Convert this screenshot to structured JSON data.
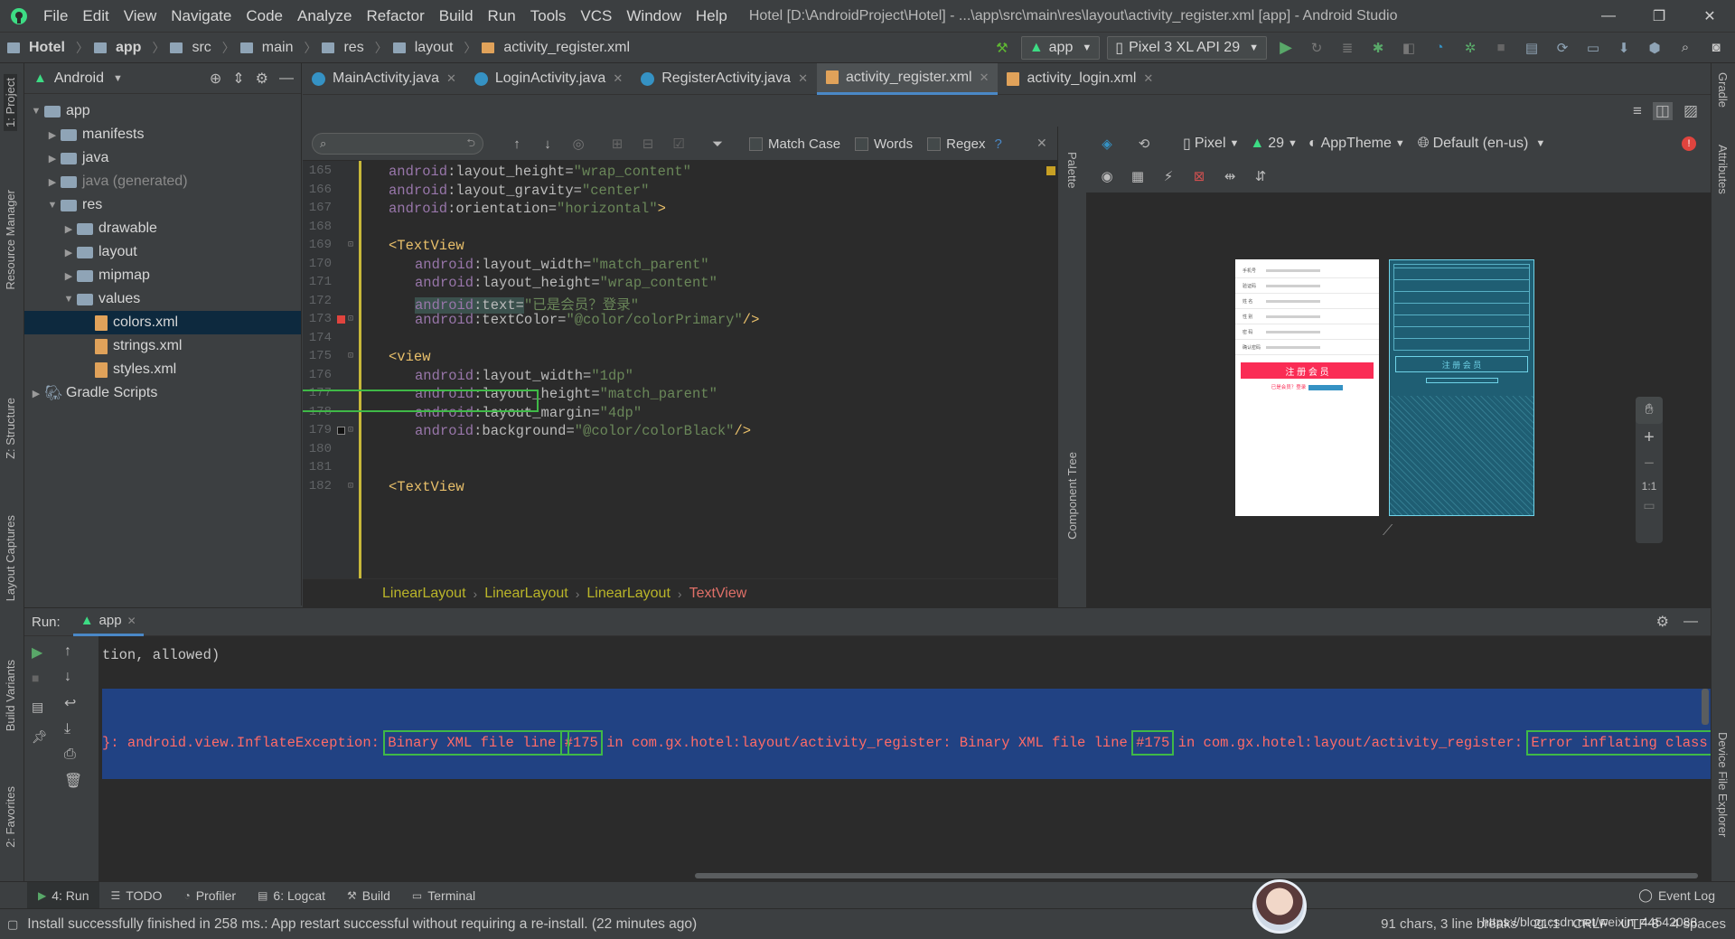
{
  "window": {
    "menu": [
      "File",
      "Edit",
      "View",
      "Navigate",
      "Code",
      "Analyze",
      "Refactor",
      "Build",
      "Run",
      "Tools",
      "VCS",
      "Window",
      "Help"
    ],
    "title": "Hotel [D:\\AndroidProject\\Hotel] - ...\\app\\src\\main\\res\\layout\\activity_register.xml [app] - Android Studio"
  },
  "breadcrumbs": [
    "Hotel",
    "app",
    "src",
    "main",
    "res",
    "layout",
    "activity_register.xml"
  ],
  "toolbar": {
    "run_config": "app",
    "device": "Pixel 3 XL API 29"
  },
  "project": {
    "view_mode": "Android",
    "tree": [
      {
        "label": "app",
        "depth": 0,
        "arrow": "▼",
        "kind": "folder"
      },
      {
        "label": "manifests",
        "depth": 1,
        "arrow": "▶",
        "kind": "folder"
      },
      {
        "label": "java",
        "depth": 1,
        "arrow": "▶",
        "kind": "folder"
      },
      {
        "label": "java (generated)",
        "depth": 1,
        "arrow": "▶",
        "kind": "folder",
        "dim": true
      },
      {
        "label": "res",
        "depth": 1,
        "arrow": "▼",
        "kind": "folder"
      },
      {
        "label": "drawable",
        "depth": 2,
        "arrow": "▶",
        "kind": "folder"
      },
      {
        "label": "layout",
        "depth": 2,
        "arrow": "▶",
        "kind": "folder"
      },
      {
        "label": "mipmap",
        "depth": 2,
        "arrow": "▶",
        "kind": "folder"
      },
      {
        "label": "values",
        "depth": 2,
        "arrow": "▼",
        "kind": "folder"
      },
      {
        "label": "colors.xml",
        "depth": 3,
        "arrow": "",
        "kind": "xml",
        "selected": true
      },
      {
        "label": "strings.xml",
        "depth": 3,
        "arrow": "",
        "kind": "xml"
      },
      {
        "label": "styles.xml",
        "depth": 3,
        "arrow": "",
        "kind": "xml"
      },
      {
        "label": "Gradle Scripts",
        "depth": 0,
        "arrow": "▶",
        "kind": "gradle"
      }
    ]
  },
  "tabs": [
    {
      "label": "MainActivity.java",
      "kind": "class",
      "active": false
    },
    {
      "label": "LoginActivity.java",
      "kind": "class",
      "active": false
    },
    {
      "label": "RegisterActivity.java",
      "kind": "class",
      "active": false
    },
    {
      "label": "activity_register.xml",
      "kind": "xml",
      "active": true
    },
    {
      "label": "activity_login.xml",
      "kind": "xml",
      "active": false
    }
  ],
  "find": {
    "match_case": "Match Case",
    "words": "Words",
    "regex": "Regex",
    "help": "?"
  },
  "code": {
    "lines": [
      {
        "n": "165",
        "indent": 0,
        "parts": [
          [
            "ns",
            "android"
          ],
          [
            "attr",
            ":layout_height="
          ],
          [
            "str",
            "\"wrap_content\""
          ]
        ]
      },
      {
        "n": "166",
        "indent": 0,
        "parts": [
          [
            "ns",
            "android"
          ],
          [
            "attr",
            ":layout_gravity="
          ],
          [
            "str",
            "\"center\""
          ]
        ]
      },
      {
        "n": "167",
        "indent": 0,
        "parts": [
          [
            "ns",
            "android"
          ],
          [
            "attr",
            ":orientation="
          ],
          [
            "str",
            "\"horizontal\""
          ],
          [
            "tag",
            ">"
          ]
        ]
      },
      {
        "n": "168",
        "indent": 0,
        "parts": []
      },
      {
        "n": "169",
        "indent": 0,
        "parts": [
          [
            "tag",
            "<TextView"
          ]
        ]
      },
      {
        "n": "170",
        "indent": 1,
        "parts": [
          [
            "ns",
            "android"
          ],
          [
            "attr",
            ":layout_width="
          ],
          [
            "str",
            "\"match_parent\""
          ]
        ]
      },
      {
        "n": "171",
        "indent": 1,
        "parts": [
          [
            "ns",
            "android"
          ],
          [
            "attr",
            ":layout_height="
          ],
          [
            "str",
            "\"wrap_content\""
          ]
        ]
      },
      {
        "n": "172",
        "indent": 1,
        "parts": [
          [
            "ns",
            "android"
          ],
          [
            "attr",
            ":text="
          ],
          [
            "str",
            "\"已是会员？登录\""
          ]
        ],
        "hl": true
      },
      {
        "n": "173",
        "indent": 1,
        "parts": [
          [
            "ns",
            "android"
          ],
          [
            "attr",
            ":textColor="
          ],
          [
            "str",
            "\"@color/colorPrimary\""
          ],
          [
            "tag",
            "/>"
          ]
        ]
      },
      {
        "n": "174",
        "indent": 0,
        "parts": []
      },
      {
        "n": "175",
        "indent": 0,
        "parts": [
          [
            "tag",
            "<view"
          ]
        ]
      },
      {
        "n": "176",
        "indent": 1,
        "parts": [
          [
            "ns",
            "android"
          ],
          [
            "attr",
            ":layout_width="
          ],
          [
            "str",
            "\"1dp\""
          ]
        ]
      },
      {
        "n": "177",
        "indent": 1,
        "parts": [
          [
            "ns",
            "android"
          ],
          [
            "attr",
            ":layout_height="
          ],
          [
            "str",
            "\"match_parent\""
          ]
        ]
      },
      {
        "n": "178",
        "indent": 1,
        "parts": [
          [
            "ns",
            "android"
          ],
          [
            "attr",
            ":layout_margin="
          ],
          [
            "str",
            "\"4dp\""
          ]
        ]
      },
      {
        "n": "179",
        "indent": 1,
        "parts": [
          [
            "ns",
            "android"
          ],
          [
            "attr",
            ":background="
          ],
          [
            "str",
            "\"@color/colorBlack\""
          ],
          [
            "tag",
            "/>"
          ]
        ]
      },
      {
        "n": "180",
        "indent": 0,
        "parts": []
      },
      {
        "n": "181",
        "indent": 0,
        "parts": []
      },
      {
        "n": "182",
        "indent": 0,
        "parts": [
          [
            "tag",
            "<TextView"
          ]
        ]
      }
    ]
  },
  "editor_breadcrumb": [
    "LinearLayout",
    "LinearLayout",
    "LinearLayout",
    "TextView"
  ],
  "design": {
    "device": "Pixel",
    "api": "29",
    "theme": "AppTheme",
    "locale": "Default (en-us)",
    "zoom_fit": "1:1"
  },
  "preview": {
    "button": "注 册 会 员",
    "login_link": "已是会员？登录",
    "fields": [
      "手机号",
      "验证码",
      "姓 名",
      "性 别",
      "密 码",
      "确认密码"
    ]
  },
  "palette_label": "Palette",
  "component_tree_label": "Component Tree",
  "run": {
    "label": "Run:",
    "config": "app",
    "prev_line": "tion, allowed)",
    "error_parts": [
      {
        "t": "}: android.view.InflateException: ",
        "box": false
      },
      {
        "t": "Binary XML file line ",
        "box": "a"
      },
      {
        "t": "#175",
        "box": "b"
      },
      {
        "t": " in com.gx.hotel:layout/activity_register: Binary XML file line ",
        "box": false
      },
      {
        "t": "#175",
        "box": "c"
      },
      {
        "t": " in com.gx.hotel:layout/activity_register: ",
        "box": false
      },
      {
        "t": "Error inflating class null",
        "box": "d"
      }
    ]
  },
  "bottom_tabs": [
    "4: Run",
    "TODO",
    "Profiler",
    "6: Logcat",
    "Build",
    "Terminal"
  ],
  "event_log": "Event Log",
  "status": {
    "message": "Install successfully finished in 258 ms.: App restart successful without requiring a re-install. (22 minutes ago)",
    "chars": "91 chars, 3 line breaks",
    "position": "21:1",
    "line_sep": "CRLF",
    "encoding": "UTF-8",
    "indent": "4 spaces",
    "watermark": "https://blog.csdn.net/weixin_44542088"
  },
  "side_tabs": {
    "left": [
      "1: Project",
      "Resource Manager",
      "Z: Structure",
      "Layout Captures",
      "Build Variants",
      "2: Favorites"
    ],
    "right": [
      "Gradle",
      "Attributes",
      "Device File Explorer"
    ]
  },
  "colors": {
    "accent": "#4a88c7",
    "error": "#ff6b68",
    "highlight_box": "#3fb947",
    "selection": "#214283"
  }
}
